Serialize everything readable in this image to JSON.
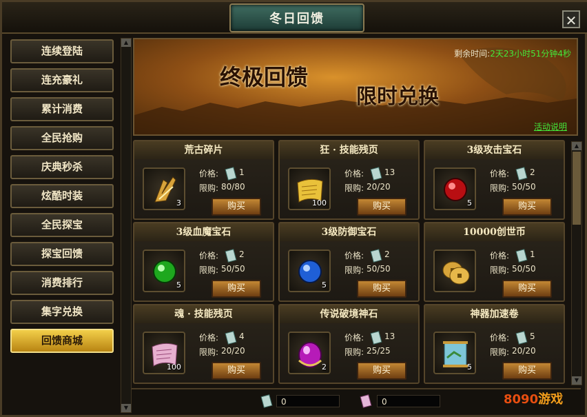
{
  "window": {
    "title": "冬日回馈",
    "close_symbol": "✕"
  },
  "sidebar": {
    "items": [
      {
        "label": "连续登陆",
        "active": false
      },
      {
        "label": "连充豪礼",
        "active": false
      },
      {
        "label": "累计消费",
        "active": false
      },
      {
        "label": "全民抢购",
        "active": false
      },
      {
        "label": "庆典秒杀",
        "active": false
      },
      {
        "label": "炫酷时装",
        "active": false
      },
      {
        "label": "全民探宝",
        "active": false
      },
      {
        "label": "探宝回馈",
        "active": false
      },
      {
        "label": "消费排行",
        "active": false
      },
      {
        "label": "集字兑换",
        "active": false
      },
      {
        "label": "回馈商城",
        "active": true
      }
    ]
  },
  "banner": {
    "headline_1": "终极回馈",
    "headline_2": "限时兑换",
    "countdown_label": "剩余时间:",
    "countdown_value": "2天23小时51分钟4秒",
    "help_link": "活动说明"
  },
  "shop": {
    "price_label": "价格:",
    "limit_label": "限购:",
    "buy_label": "购买",
    "items": [
      {
        "name": "荒古碎片",
        "price": "1",
        "limit": "80/80",
        "qty": "3",
        "icon": "shard-icon"
      },
      {
        "name": "狂 · 技能残页",
        "price": "13",
        "limit": "20/20",
        "qty": "100",
        "icon": "gold-scroll-icon"
      },
      {
        "name": "3级攻击宝石",
        "price": "2",
        "limit": "50/50",
        "qty": "5",
        "icon": "red-gem-icon"
      },
      {
        "name": "3级血魔宝石",
        "price": "2",
        "limit": "50/50",
        "qty": "5",
        "icon": "green-gem-icon"
      },
      {
        "name": "3级防御宝石",
        "price": "2",
        "limit": "50/50",
        "qty": "5",
        "icon": "blue-gem-icon"
      },
      {
        "name": "10000创世币",
        "price": "1",
        "limit": "50/50",
        "qty": "",
        "icon": "coins-icon"
      },
      {
        "name": "魂 · 技能残页",
        "price": "4",
        "limit": "20/20",
        "qty": "100",
        "icon": "pink-scroll-icon"
      },
      {
        "name": "传说破境神石",
        "price": "13",
        "limit": "25/25",
        "qty": "2",
        "icon": "purple-stone-icon"
      },
      {
        "name": "神器加速卷",
        "price": "5",
        "limit": "20/20",
        "qty": "5",
        "icon": "map-scroll-icon"
      }
    ]
  },
  "footer": {
    "currency_1_value": "0",
    "currency_2_value": "0",
    "logo_number": "8090",
    "logo_text": "游戏"
  },
  "colors": {
    "accent_gold": "#f3cf4a",
    "timer_green": "#44e83a",
    "brand_orange": "#e84e10"
  }
}
